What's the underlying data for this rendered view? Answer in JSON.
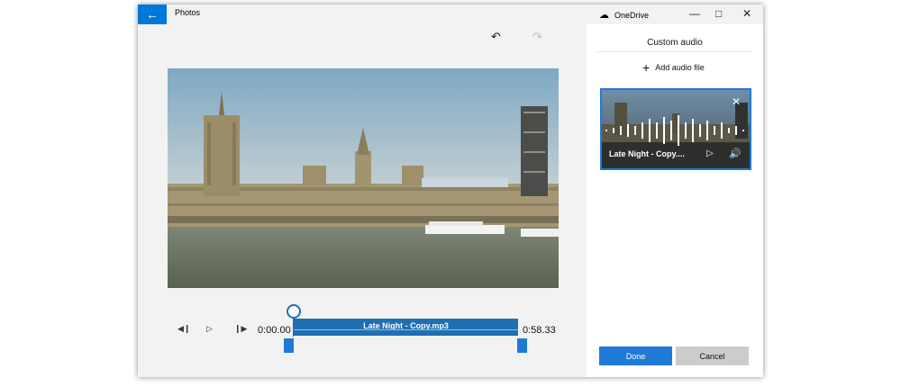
{
  "window": {
    "app_title": "Photos",
    "cloud_label": "OneDrive"
  },
  "icons": {
    "back": "arrow-left-icon",
    "undo": "undo-icon",
    "redo": "redo-icon",
    "cloud": "cloud-off-icon",
    "minimize": "minimize-icon",
    "maximize": "maximize-icon",
    "close": "close-icon"
  },
  "player": {
    "start_time": "0:00.00",
    "end_time": "0:58.33",
    "track_label": "Late Night - Copy.mp3",
    "playhead_position": 0
  },
  "panel": {
    "title": "Custom audio",
    "add_audio_label": "Add audio file",
    "audio_card": {
      "title": "Late Night - Copy...."
    },
    "done_label": "Done",
    "cancel_label": "Cancel"
  },
  "colors": {
    "accent": "#1f7ad6",
    "track": "#1f6fb3",
    "back_button": "#0078d7"
  }
}
